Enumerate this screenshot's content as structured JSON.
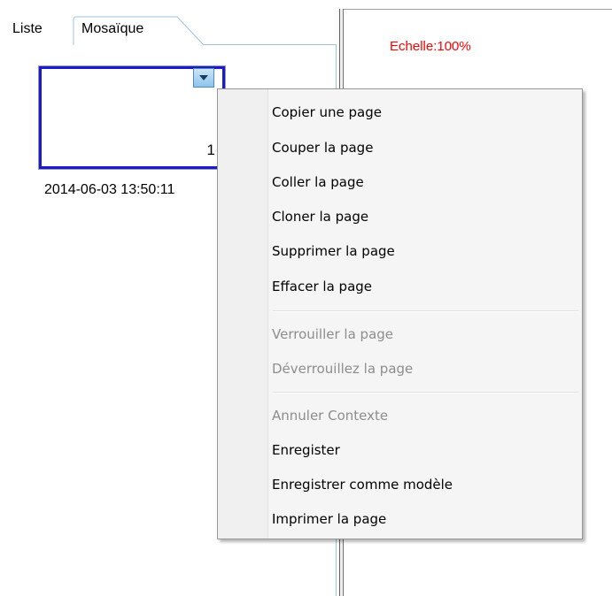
{
  "tabs": [
    {
      "label": "Liste"
    },
    {
      "label": "Mosaïque"
    }
  ],
  "thumbnail": {
    "page_number": "1",
    "timestamp": "2014-06-03 13:50:11"
  },
  "scale": {
    "label": "Echelle:100%"
  },
  "context_menu": {
    "items": [
      {
        "label": "Copier une page",
        "enabled": true
      },
      {
        "label": "Couper la page",
        "enabled": true
      },
      {
        "label": "Coller la page",
        "enabled": true
      },
      {
        "label": "Cloner la page",
        "enabled": true
      },
      {
        "label": "Supprimer la page",
        "enabled": true
      },
      {
        "label": "Effacer la page",
        "enabled": true
      },
      {
        "label": "Verrouiller la page",
        "enabled": false
      },
      {
        "label": "Déverrouillez la page",
        "enabled": false
      },
      {
        "label": "Annuler Contexte",
        "enabled": false
      },
      {
        "label": "Enregister",
        "enabled": true
      },
      {
        "label": "Enregistrer comme modèle",
        "enabled": true
      },
      {
        "label": "Imprimer la page",
        "enabled": true
      }
    ]
  },
  "colors": {
    "scale_text": "#ff0000",
    "selection_border": "#1a1ad0",
    "disabled_text": "#8d8d8d"
  }
}
